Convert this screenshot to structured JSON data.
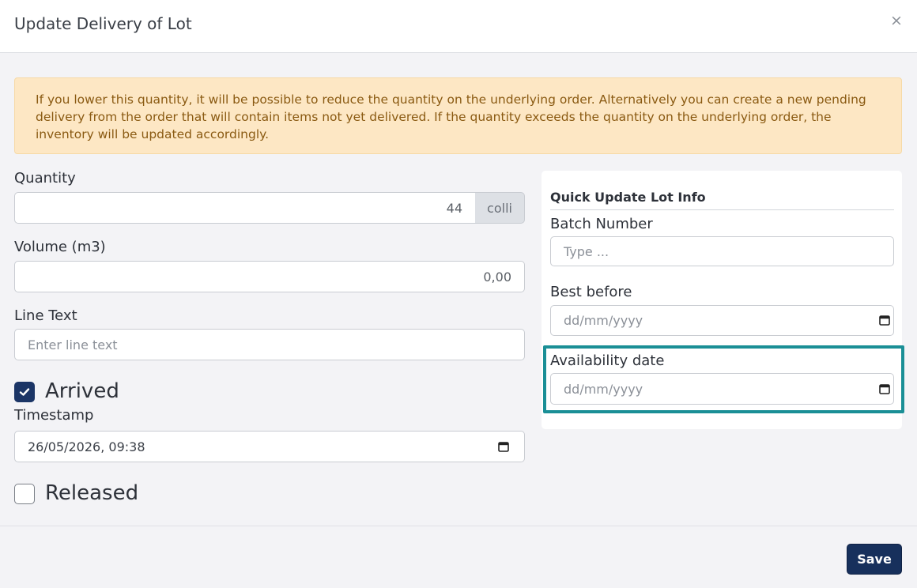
{
  "dialog": {
    "title": "Update Delivery of Lot",
    "close_symbol": "×"
  },
  "alert": {
    "text": "If you lower this quantity, it will be possible to reduce the quantity on the underlying order. Alternatively you can create a new pending delivery from the order that will contain items not yet delivered. If the quantity exceeds the quantity on the underlying order, the inventory will be updated accordingly."
  },
  "form": {
    "quantity": {
      "label": "Quantity",
      "value": "44",
      "unit": "colli"
    },
    "volume": {
      "label": "Volume (m3)",
      "value": "0,00"
    },
    "line_text": {
      "label": "Line Text",
      "placeholder": "Enter line text"
    },
    "arrived": {
      "label": "Arrived",
      "checked": true
    },
    "timestamp": {
      "label": "Timestamp",
      "value": "26/05/2026, 09:38"
    },
    "released": {
      "label": "Released",
      "checked": false
    }
  },
  "lot_info": {
    "title": "Quick Update Lot Info",
    "batch_number": {
      "label": "Batch Number",
      "placeholder": "Type ..."
    },
    "best_before": {
      "label": "Best before",
      "placeholder": "dd/mm/yyyy"
    },
    "availability_date": {
      "label": "Availability date",
      "placeholder": "dd/mm/yyyy"
    }
  },
  "footer": {
    "save_label": "Save"
  },
  "colors": {
    "primary": "#17305c",
    "highlight": "#1a8f96",
    "alert_bg": "#fde7c4",
    "alert_text": "#8a5a12"
  },
  "icons": {
    "calendar": "calendar-icon",
    "check": "check-icon",
    "close": "close-icon"
  }
}
